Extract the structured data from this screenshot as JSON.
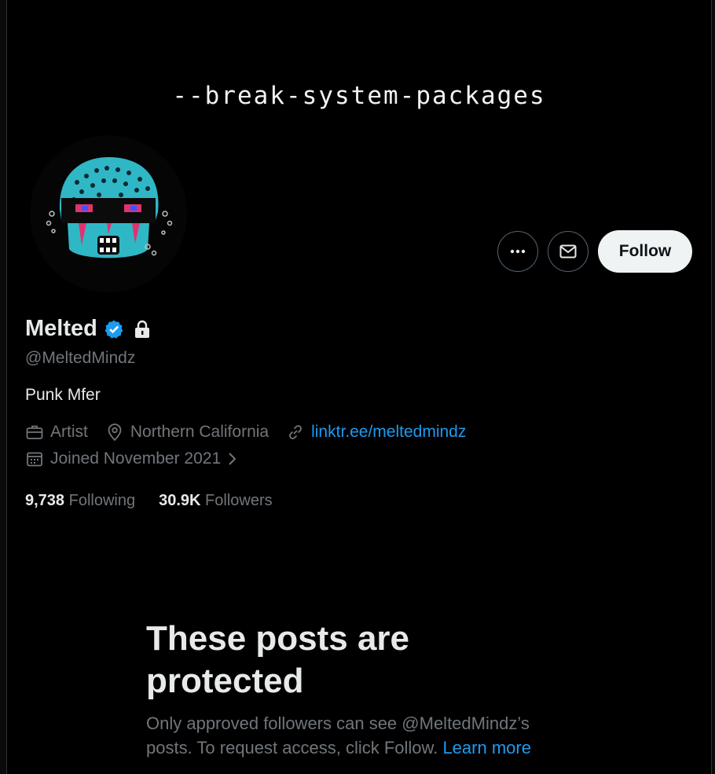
{
  "banner": {
    "text": "--break-system-packages"
  },
  "actions": {
    "more_icon": "more-dots-icon",
    "message_icon": "envelope-icon",
    "follow_label": "Follow"
  },
  "profile": {
    "name": "Melted",
    "handle": "@MeltedMindz",
    "bio": "Punk Mfer",
    "verified_icon": "verified-badge-icon",
    "protected_icon": "lock-icon",
    "profession": "Artist",
    "location": "Northern California",
    "website": "linktr.ee/meltedmindz",
    "joined": "Joined November 2021"
  },
  "stats": {
    "following_count": "9,738",
    "following_label": "Following",
    "followers_count": "30.9K",
    "followers_label": "Followers"
  },
  "protected_notice": {
    "title": "These posts are protected",
    "body": "Only approved followers can see @MeltedMindz’s posts. To request access, click Follow.",
    "link": "Learn more"
  },
  "colors": {
    "accent": "#1d9bf0",
    "muted": "#71767b",
    "text": "#e7e9ea",
    "background": "#000000"
  }
}
